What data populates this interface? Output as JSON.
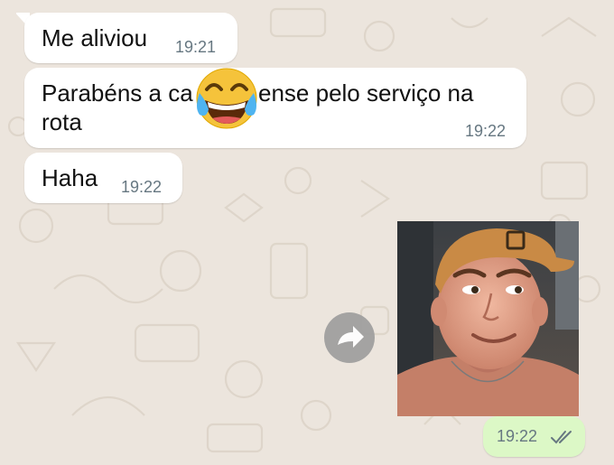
{
  "chat": {
    "messages": [
      {
        "direction": "incoming",
        "text": "Me aliviou",
        "time": "19:21"
      },
      {
        "direction": "incoming",
        "line1": "Parabéns a ca",
        "line1_end": "ense pelo serviço na",
        "line2": "rota",
        "time": "19:22",
        "overlay_emoji": "face-with-tears-of-joy"
      },
      {
        "direction": "incoming",
        "text": "Haha",
        "time": "19:22"
      },
      {
        "direction": "outgoing",
        "type": "photo",
        "photo_description": "young man with backwards orange cap smiling",
        "time": "19:22",
        "status": "read"
      }
    ]
  },
  "colors": {
    "wallpaper": "#ece5dd",
    "incoming_bubble": "#ffffff",
    "outgoing_bubble": "#dcf8c6",
    "read_ticks": "#667781",
    "time_text": "#667781"
  },
  "icons": {
    "forward": "share-arrow-icon",
    "status": "double-check-icon",
    "emoji": "face-with-tears-of-joy-icon"
  }
}
